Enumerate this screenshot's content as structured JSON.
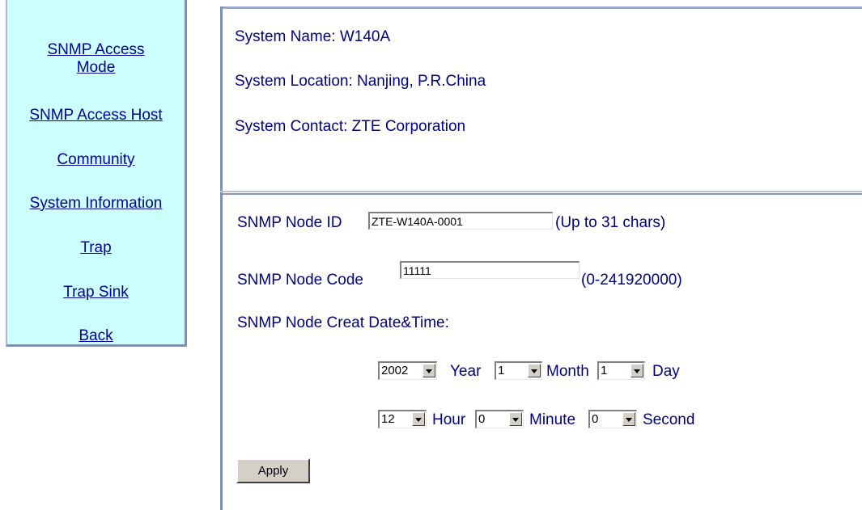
{
  "nav": {
    "items": [
      {
        "label_line1": "SNMP Access",
        "label_line2": "Mode"
      },
      {
        "label": "SNMP Access Host"
      },
      {
        "label": "Community"
      },
      {
        "label": "System Information"
      },
      {
        "label": "Trap"
      },
      {
        "label": "Trap Sink"
      },
      {
        "label": "Back"
      }
    ]
  },
  "system": {
    "name": "System Name: W140A",
    "location": "System Location: Nanjing, P.R.China",
    "contact": "System Contact: ZTE Corporation"
  },
  "form": {
    "node_id_label": "SNMP Node ID",
    "node_id_value": "ZTE-W140A-0001",
    "node_id_hint": "(Up to 31 chars)",
    "node_code_label": "SNMP Node Code",
    "node_code_value": "11111",
    "node_code_hint": "(0-241920000)",
    "datetime_label": "SNMP Node Creat Date&Time:",
    "year": {
      "value": "2002",
      "unit": "Year"
    },
    "month": {
      "value": "1",
      "unit": "Month"
    },
    "day": {
      "value": "1",
      "unit": "Day"
    },
    "hour": {
      "value": "12",
      "unit": "Hour"
    },
    "minute": {
      "value": "0",
      "unit": "Minute"
    },
    "second": {
      "value": "0",
      "unit": "Second"
    },
    "apply_label": "Apply"
  },
  "colors": {
    "nav_background": "#ccffff",
    "link_color": "#000099",
    "text_color": "#000080"
  }
}
